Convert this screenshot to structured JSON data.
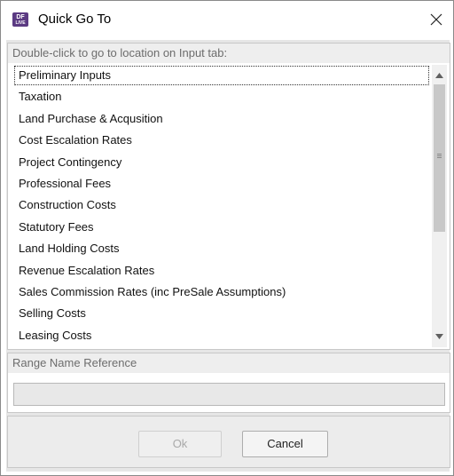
{
  "window": {
    "title": "Quick Go To",
    "app_icon_line1": "DF",
    "app_icon_line2": "LIVE"
  },
  "list": {
    "header": "Double-click to go to location on Input tab:",
    "selected_index": 0,
    "items": [
      "Preliminary Inputs",
      "Taxation",
      "Land Purchase & Acqusition",
      "Cost Escalation Rates",
      "Project Contingency",
      "Professional Fees",
      "Construction Costs",
      "Statutory Fees",
      "Land Holding Costs",
      "Revenue Escalation Rates",
      "Sales Commission Rates (inc PreSale Assumptions)",
      "Selling Costs",
      "Leasing Costs"
    ]
  },
  "range": {
    "label": "Range Name Reference",
    "value": ""
  },
  "buttons": {
    "ok": "Ok",
    "ok_enabled": false,
    "cancel": "Cancel"
  },
  "colors": {
    "icon_purple": "#5b3a82",
    "section_header_bg": "#eeeeee",
    "client_bg": "#e6e6e6"
  },
  "icons": {
    "close": "close-icon",
    "scroll_up": "chevron-up-icon",
    "scroll_down": "chevron-down-icon"
  }
}
